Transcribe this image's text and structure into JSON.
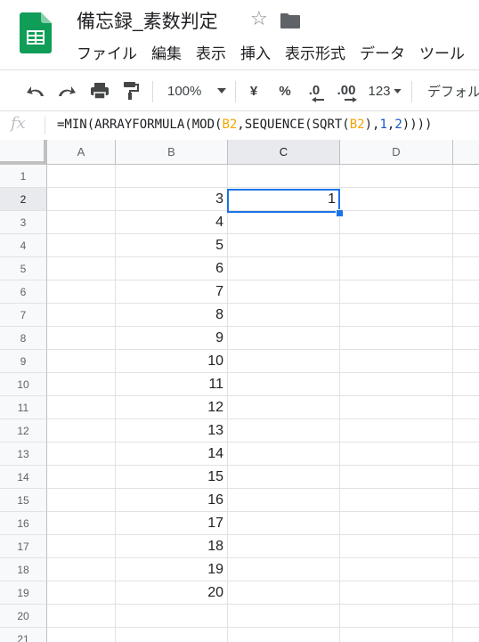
{
  "app": {
    "title": "備忘録_素数判定",
    "menu": [
      "ファイル",
      "編集",
      "表示",
      "挿入",
      "表示形式",
      "データ",
      "ツール"
    ]
  },
  "toolbar": {
    "zoom": "100%",
    "currency": "¥",
    "percent": "%",
    "decrease_decimal": ".0",
    "increase_decimal": ".00",
    "more_formats": "123",
    "font": "デフォルト"
  },
  "formula_bar": {
    "fx": "fx",
    "p1": "=MIN(ARRAYFORMULA(MOD(",
    "r1": "B2",
    "p2": ",SEQUENCE(SQRT(",
    "r2": "B2",
    "p3": "),",
    "n1": "1",
    "p4": ",",
    "n2": "2",
    "p5": "))))"
  },
  "grid": {
    "columns": [
      "A",
      "B",
      "C",
      "D"
    ],
    "rows": [
      "1",
      "2",
      "3",
      "4",
      "5",
      "6",
      "7",
      "8",
      "9",
      "10",
      "11",
      "12",
      "13",
      "14",
      "15",
      "16",
      "17",
      "18",
      "19",
      "20",
      "21"
    ],
    "column_b": [
      "",
      "3",
      "4",
      "5",
      "6",
      "7",
      "8",
      "9",
      "10",
      "11",
      "12",
      "13",
      "14",
      "15",
      "16",
      "17",
      "18",
      "19",
      "20",
      "",
      ""
    ],
    "column_c": [
      "",
      "1",
      "",
      "",
      "",
      "",
      "",
      "",
      "",
      "",
      "",
      "",
      "",
      "",
      "",
      "",
      "",
      "",
      "",
      "",
      ""
    ],
    "selected_cell": "C2"
  },
  "colors": {
    "sheets_green": "#0f9d58",
    "selection_blue": "#1a73e8",
    "formula_ref": "#f4a300",
    "formula_number": "#1155cc"
  },
  "icons": [
    "sheets-logo-icon",
    "star-icon",
    "folder-icon",
    "undo-icon",
    "redo-icon",
    "print-icon",
    "paint-format-icon",
    "chevron-down-icon"
  ]
}
